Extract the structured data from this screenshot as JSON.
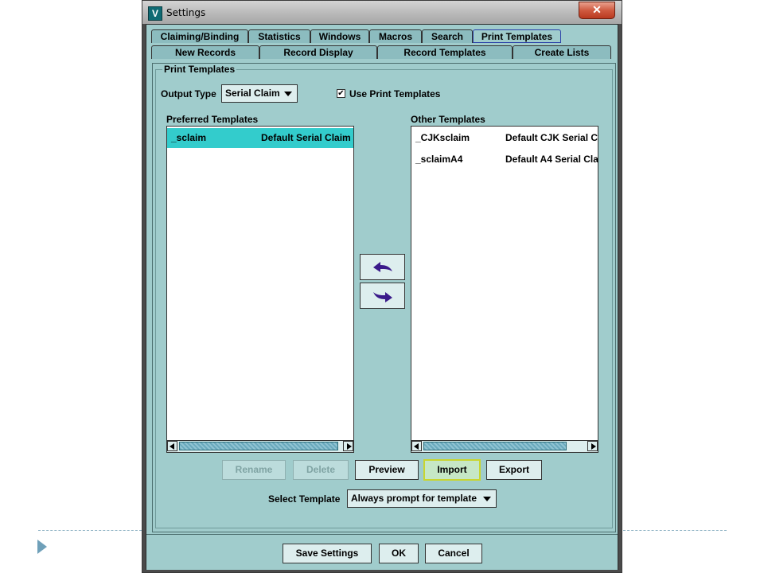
{
  "window": {
    "title": "Settings",
    "app_icon_letter": "V",
    "close_symbol": "✕"
  },
  "tabs": {
    "row1": [
      {
        "label": "Claiming/Binding"
      },
      {
        "label": "Statistics"
      },
      {
        "label": "Windows"
      },
      {
        "label": "Macros"
      },
      {
        "label": "Search"
      },
      {
        "label": "Print Templates"
      }
    ],
    "row2": [
      {
        "label": "New Records"
      },
      {
        "label": "Record Display"
      },
      {
        "label": "Record Templates"
      },
      {
        "label": "Create Lists"
      }
    ]
  },
  "print_templates": {
    "group_title": "Print Templates",
    "output_type_label": "Output Type",
    "output_type_value": "Serial Claim",
    "use_print_templates_label": "Use Print Templates",
    "use_print_templates_checked": true,
    "check_mark": "✔",
    "preferred_label": "Preferred Templates",
    "other_label": "Other Templates",
    "preferred": [
      {
        "name": "_sclaim",
        "desc": "Default Serial Claim"
      }
    ],
    "other": [
      {
        "name": "_CJKsclaim",
        "desc": "Default CJK Serial C"
      },
      {
        "name": "_sclaimA4",
        "desc": "Default A4 Serial Cla"
      }
    ],
    "buttons": {
      "rename": "Rename",
      "delete": "Delete",
      "preview": "Preview",
      "import": "Import",
      "export": "Export"
    },
    "select_template_label": "Select Template",
    "select_template_value": "Always prompt for template"
  },
  "footer": {
    "save": "Save Settings",
    "ok": "OK",
    "cancel": "Cancel"
  },
  "colors": {
    "panel_bg": "#a0cccc",
    "selection": "#33cccc",
    "arrow_icon": "#3a1a8a"
  },
  "icons": [
    "move-left-arrow-icon",
    "move-right-arrow-icon",
    "dropdown-caret-icon",
    "close-icon",
    "app-icon"
  ]
}
